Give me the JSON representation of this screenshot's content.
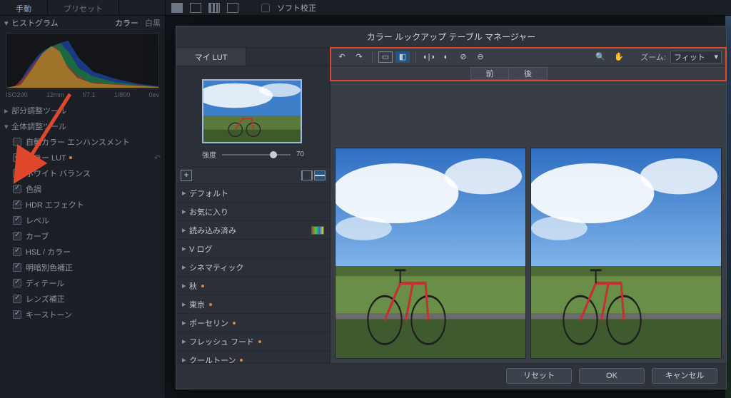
{
  "leftTabs": {
    "manual": "手動",
    "preset": "プリセット"
  },
  "histogram": {
    "title": "ヒストグラム",
    "mode_color": "カラー",
    "mode_bw": "白黒",
    "labels": {
      "iso": "ISO200",
      "focal": "12mm",
      "aperture": "f/7.1",
      "shutter": "1/800",
      "ev": "0ev"
    }
  },
  "groups": {
    "partial": "部分調整ツール",
    "global": "全体調整ツール"
  },
  "adjust": {
    "auto_color": "自動カラー エンハンスメント",
    "color_lut": "カラー LUT",
    "white_balance": "ホワイト バランス",
    "tone": "色調",
    "hdr": "HDR エフェクト",
    "level": "レベル",
    "curve": "カーブ",
    "hsl": "HSL / カラー",
    "lum_fix": "明暗別色補正",
    "detail": "ディテール",
    "lens": "レンズ補正",
    "keystone": "キーストーン"
  },
  "top": {
    "soft_proof": "ソフト校正"
  },
  "modal": {
    "title": "カラー ルックアップ テーブル マネージャー",
    "mylut": "マイ LUT",
    "strength_label": "強度",
    "strength_value": "70",
    "categories": {
      "default": "デフォルト",
      "favorite": "お気に入り",
      "loaded": "読み込み済み",
      "vlog": "V ログ",
      "cinematic": "シネマティック",
      "autumn": "秋",
      "tokyo": "東京",
      "porcelain": "ポーセリン",
      "fresh_food": "フレッシュ フード",
      "cool_tone": "クールトーン"
    },
    "zoom_label": "ズーム:",
    "zoom_value": "フィット",
    "before": "前",
    "after": "後",
    "reset": "リセット",
    "ok": "OK",
    "cancel": "キャンセル"
  }
}
